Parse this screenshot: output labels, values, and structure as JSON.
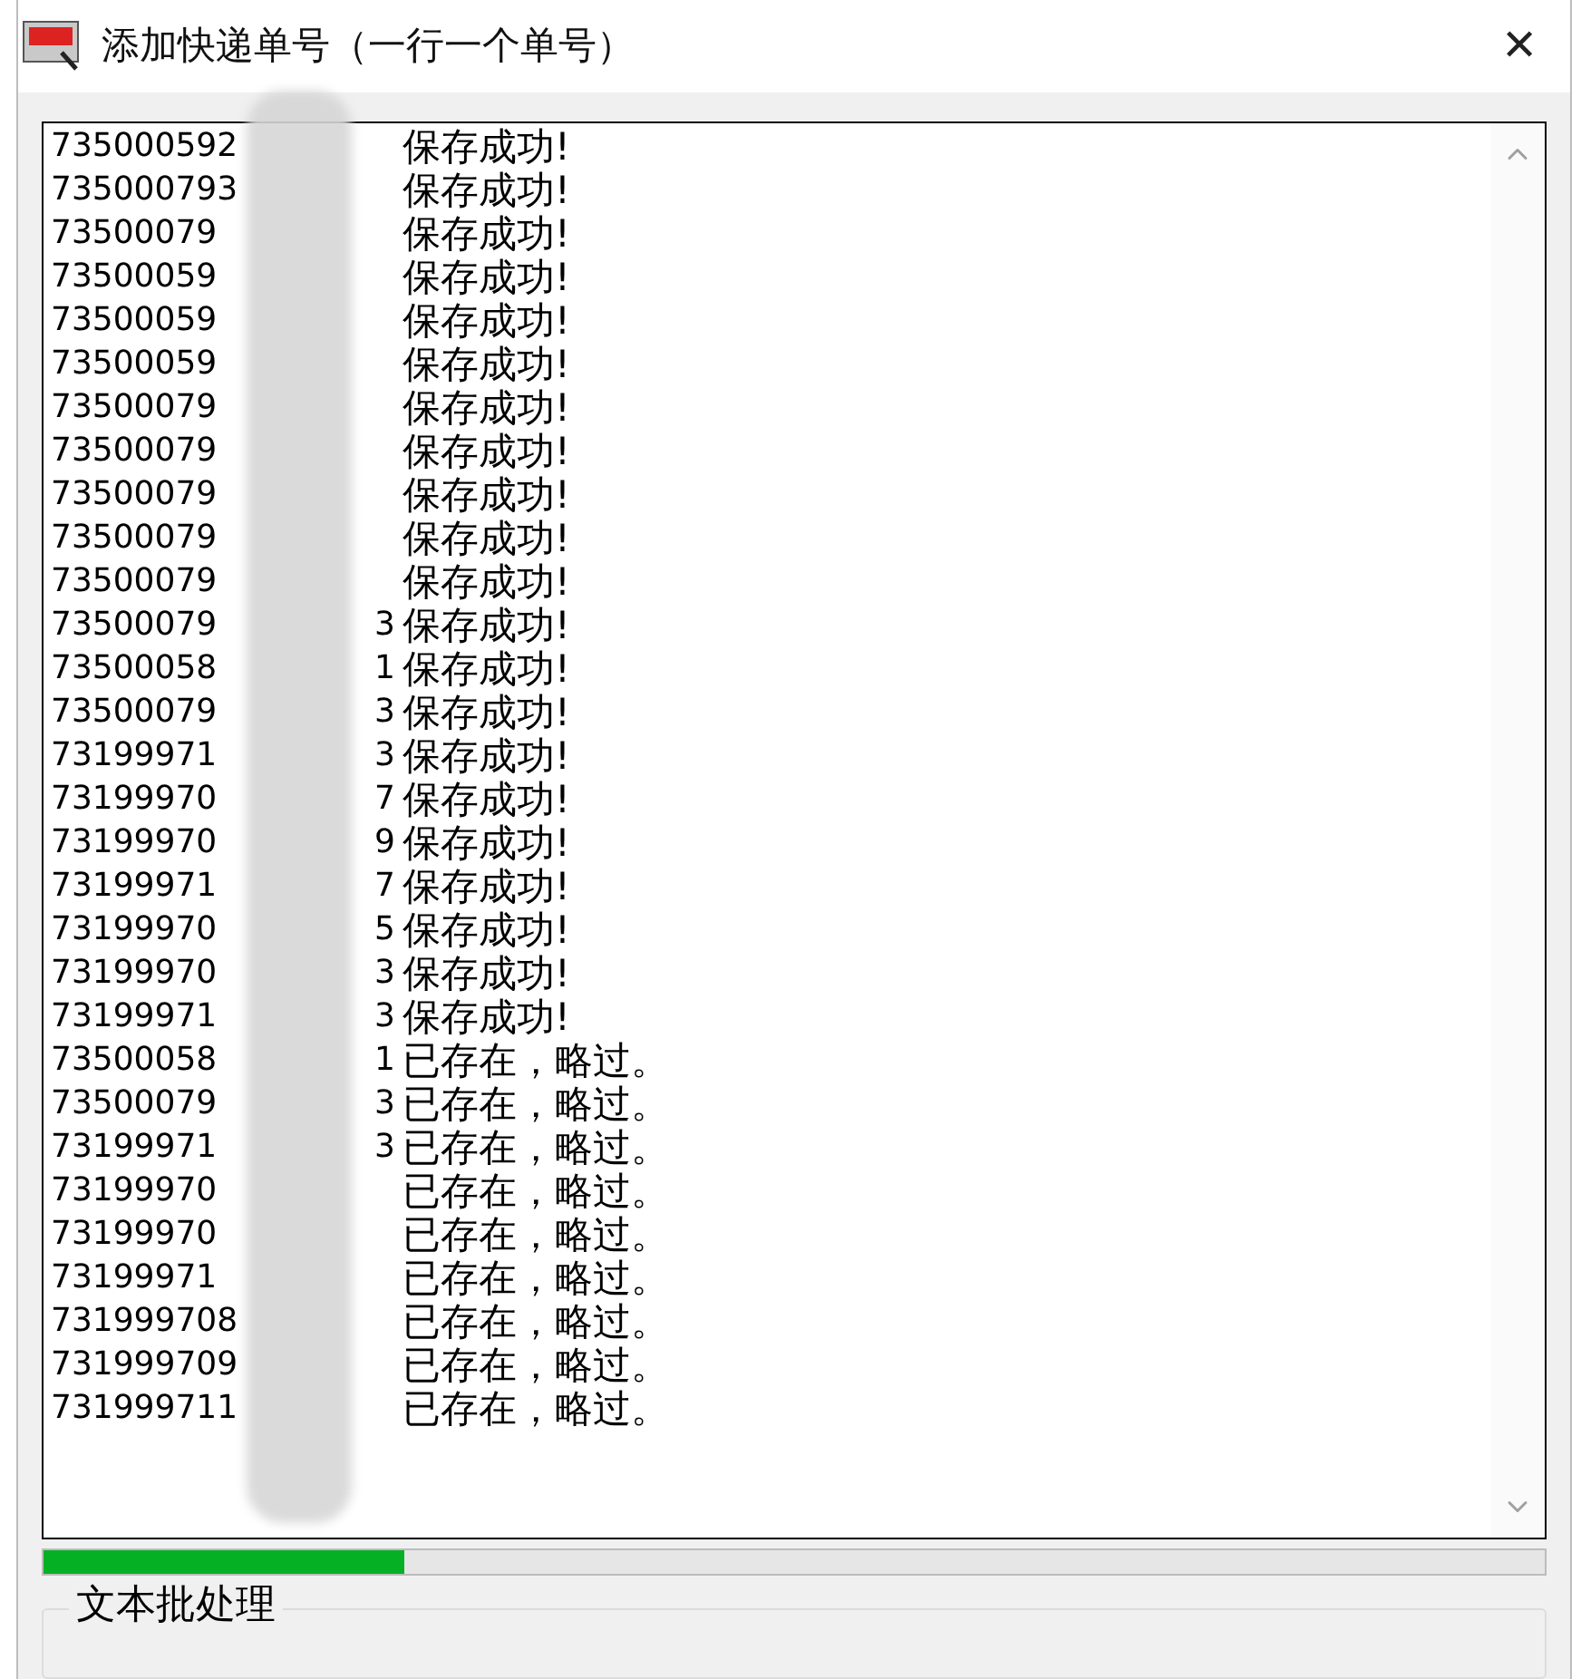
{
  "window": {
    "title": "添加快递单号（一行一个单号）",
    "close": "✕"
  },
  "log": [
    {
      "number": "735000592",
      "status": "保存成功!"
    },
    {
      "number": "735000793",
      "status": "保存成功!"
    },
    {
      "number": "73500079",
      "status": "保存成功!"
    },
    {
      "number": "73500059",
      "status": "保存成功!"
    },
    {
      "number": "73500059",
      "status": "保存成功!"
    },
    {
      "number": "73500059",
      "status": "保存成功!"
    },
    {
      "number": "73500079",
      "status": "保存成功!"
    },
    {
      "number": "73500079",
      "status": "保存成功!"
    },
    {
      "number": "73500079",
      "status": "保存成功!"
    },
    {
      "number": "73500079",
      "status": "保存成功!"
    },
    {
      "number": "73500079",
      "status": "保存成功!"
    },
    {
      "number": "73500079",
      "suffix": "3",
      "status": "保存成功!"
    },
    {
      "number": "73500058",
      "suffix": "1",
      "status": "保存成功!"
    },
    {
      "number": "73500079",
      "suffix": "3",
      "status": "保存成功!"
    },
    {
      "number": "73199971",
      "suffix": "3",
      "status": "保存成功!"
    },
    {
      "number": "73199970",
      "suffix": "7",
      "status": "保存成功!"
    },
    {
      "number": "73199970",
      "suffix": "9",
      "status": "保存成功!"
    },
    {
      "number": "73199971",
      "suffix": "7",
      "status": "保存成功!"
    },
    {
      "number": "73199970",
      "suffix": "5",
      "status": "保存成功!"
    },
    {
      "number": "73199970",
      "suffix": "3",
      "status": "保存成功!"
    },
    {
      "number": "73199971",
      "suffix": "3",
      "status": "保存成功!"
    },
    {
      "number": "73500058",
      "suffix": "1",
      "status": "已存在，略过。"
    },
    {
      "number": "73500079",
      "suffix": "3",
      "status": "已存在，略过。"
    },
    {
      "number": "73199971",
      "suffix": "3",
      "status": "已存在，略过。"
    },
    {
      "number": "73199970",
      "status": "已存在，略过。"
    },
    {
      "number": "73199970",
      "status": "已存在，略过。"
    },
    {
      "number": "73199971",
      "status": "已存在，略过。"
    },
    {
      "number": "731999708",
      "status": "已存在，略过。"
    },
    {
      "number": "731999709",
      "status": "已存在，略过。"
    },
    {
      "number": "731999711",
      "status": "已存在，略过。"
    }
  ],
  "progress": {
    "level": 0.24
  },
  "group": {
    "title": "文本批处理"
  }
}
